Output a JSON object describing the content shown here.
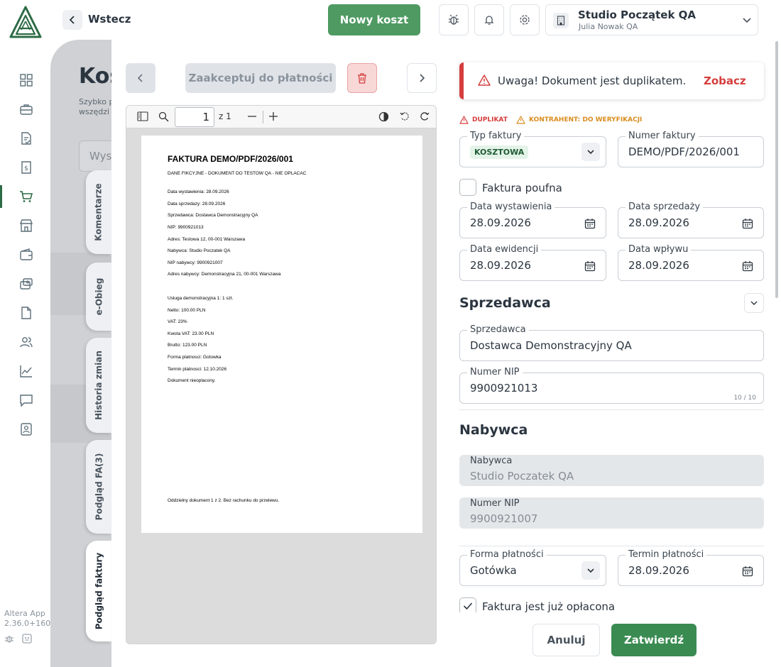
{
  "header": {
    "back_label": "Wstecz",
    "new_cost_label": "Nowy koszt",
    "company_name": "Studio Początek QA",
    "company_user": "Julia Nowak QA",
    "icons": [
      "bug-icon",
      "bell-icon",
      "gear-icon"
    ]
  },
  "sidebar": {
    "items": [
      "dashboard",
      "briefcase",
      "invoice",
      "receipt",
      "cart",
      "store",
      "wallet",
      "payments",
      "document",
      "users",
      "chart",
      "chat",
      "contact"
    ],
    "active": "cart",
    "app_name": "Altera App",
    "app_version": "2.36.0+1602"
  },
  "background": {
    "title": "Kos",
    "subtitle_line1": "Szybko p",
    "subtitle_line2": "wszędzi",
    "search_placeholder": "Wysz"
  },
  "tabs": [
    {
      "label": "Komentarze"
    },
    {
      "label": "e-Obieg"
    },
    {
      "label": "Historia zmian"
    },
    {
      "label": "Podgląd FA(3)"
    },
    {
      "label": "Podgląd faktury"
    }
  ],
  "preview": {
    "accept_label": "Zaakceptuj do płatności",
    "page_current": "1",
    "page_total": "z 1",
    "document": {
      "title": "FAKTURA DEMO/PDF/2026/001",
      "lines": [
        "DANE FIKCYJNE - DOKUMENT DO TESTOW QA - NIE OPLACAC",
        "Data wystawienia: 28.09.2026",
        "Data sprzedazy: 28.09.2026",
        "Sprzedawca: Dostawca Demonstracyjny QA",
        "NIP: 9900921013",
        "Adres: Testowa 12, 00-001 Warszawa",
        "Nabywca: Studio Poczatek QA",
        "NIP nabywcy: 9900921007",
        "Adres nabywcy: Demonstracyjna 21, 00-001 Warszawa",
        "Usluga demonstracyjna 1: 1 szt.",
        "Netto: 100.00 PLN",
        "VAT: 23%",
        "Kwota VAT: 23.00 PLN",
        "Brutto: 123.00 PLN",
        "Forma platnosci: Gotowka",
        "Termin platnosci: 12.10.2026",
        "Dokument nieoplacony.",
        "Oddzielny dokument 1 z 2. Bez rachunku do przelewu."
      ]
    }
  },
  "form": {
    "alert_text": "Uwaga! Dokument jest duplikatem.",
    "alert_link": "Zobacz",
    "tag_duplicate": "DUPLIKAT",
    "tag_contractor": "KONTRAHENT: DO WERYFIKACJI",
    "invoice_type_label": "Typ faktury",
    "invoice_type_value": "KOSZTOWA",
    "invoice_number_label": "Numer faktury",
    "invoice_number_value": "DEMO/PDF/2026/001",
    "confidential_label": "Faktura poufna",
    "issue_date_label": "Data wystawienia",
    "issue_date_value": "28.09.2026",
    "sale_date_label": "Data sprzedaży",
    "sale_date_value": "28.09.2026",
    "record_date_label": "Data ewidencji",
    "record_date_value": "28.09.2026",
    "receipt_date_label": "Data wpływu",
    "receipt_date_value": "28.09.2026",
    "seller_section": "Sprzedawca",
    "seller_label": "Sprzedawca",
    "seller_value": "Dostawca Demonstracyjny QA",
    "seller_nip_label": "Numer NIP",
    "seller_nip_value": "9900921013",
    "seller_nip_counter": "10 / 10",
    "buyer_section": "Nabywca",
    "buyer_label": "Nabywca",
    "buyer_value": "Studio Poczatek QA",
    "buyer_nip_label": "Numer NIP",
    "buyer_nip_value": "9900921007",
    "payment_form_label": "Forma płatności",
    "payment_form_value": "Gotówka",
    "payment_due_label": "Termin płatności",
    "payment_due_value": "28.09.2026",
    "paid_label": "Faktura jest już opłacona",
    "paid_checked": true
  },
  "footer": {
    "cancel_label": "Anuluj",
    "confirm_label": "Zatwierdź"
  },
  "colors": {
    "primary": "#4e9a62",
    "danger": "#d63d3d",
    "warning": "#d98c1e"
  }
}
